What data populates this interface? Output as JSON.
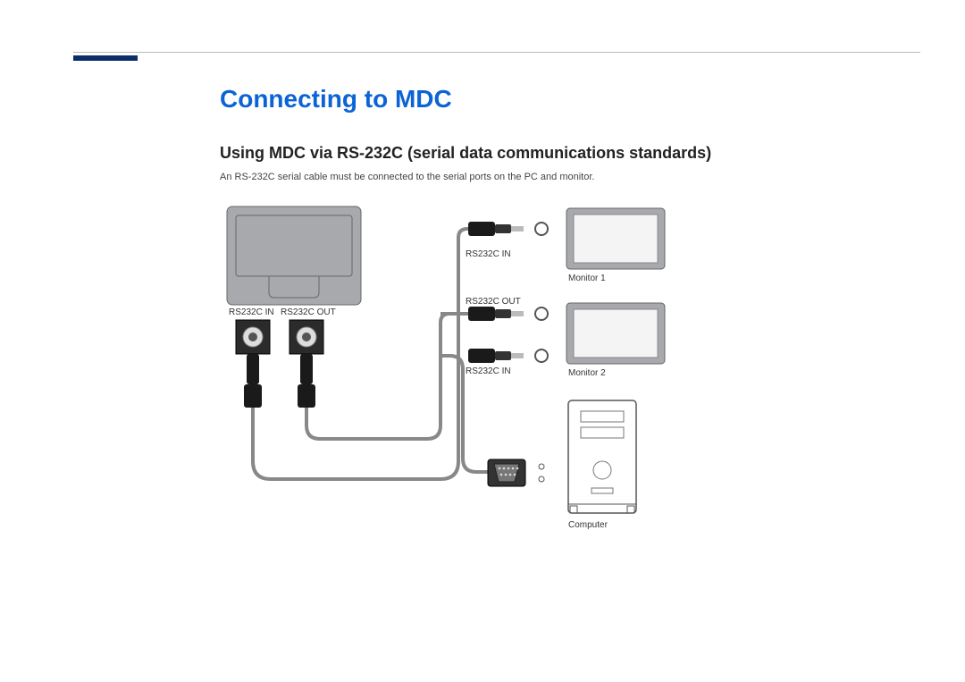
{
  "heading": "Connecting to MDC",
  "subheading": "Using MDC via RS-232C (serial data communications standards)",
  "description": "An RS-232C serial cable must be connected to the serial ports on the PC and monitor.",
  "labels": {
    "back_in": "RS232C IN",
    "back_out": "RS232C OUT",
    "jack_in_1": "RS232C IN",
    "jack_out": "RS232C OUT",
    "jack_in_2": "RS232C IN",
    "monitor1": "Monitor 1",
    "monitor2": "Monitor 2",
    "computer": "Computer"
  }
}
